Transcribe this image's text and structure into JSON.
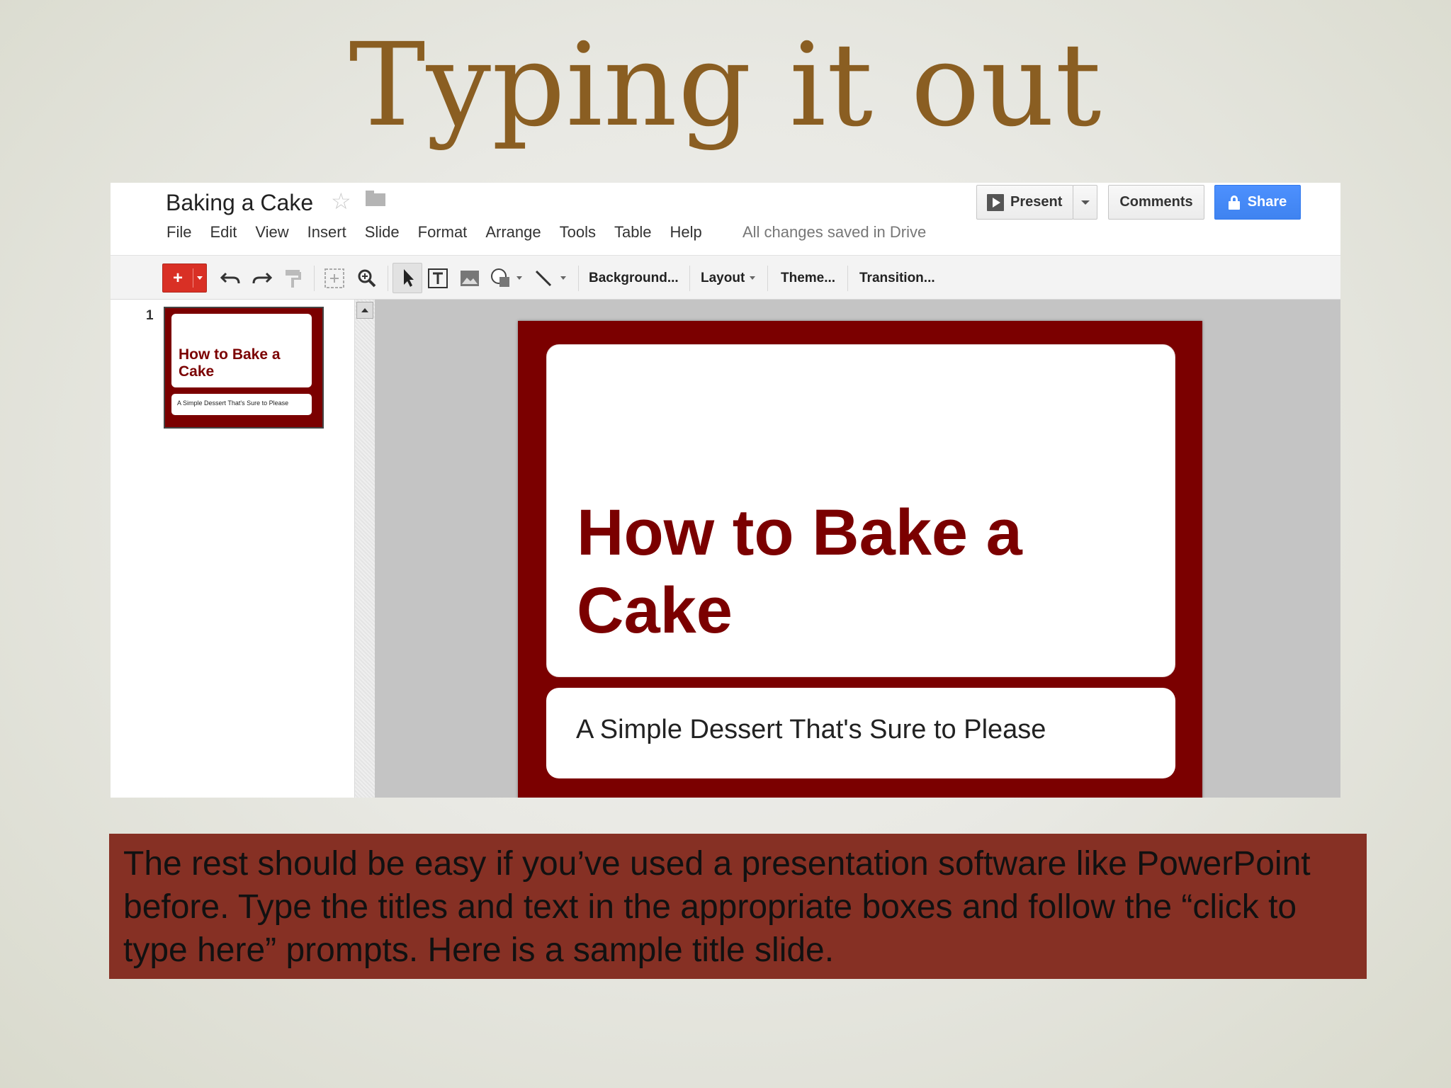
{
  "slide_heading": "Typing it out",
  "app": {
    "doc_title": "Baking a Cake",
    "menu": [
      "File",
      "Edit",
      "View",
      "Insert",
      "Slide",
      "Format",
      "Arrange",
      "Tools",
      "Table",
      "Help"
    ],
    "save_status": "All changes saved in Drive",
    "buttons": {
      "present": "Present",
      "comments": "Comments",
      "share": "Share"
    },
    "toolbar": {
      "new_slide": "+",
      "background": "Background...",
      "layout": "Layout",
      "theme": "Theme...",
      "transition": "Transition..."
    },
    "icons": [
      "star-icon",
      "folder-icon",
      "play-icon",
      "lock-icon",
      "undo-icon",
      "redo-icon",
      "paint-format-icon",
      "zoom-fit-icon",
      "zoom-icon",
      "cursor-icon",
      "text-box-icon",
      "image-icon",
      "shape-icon",
      "line-icon"
    ],
    "filmstrip": {
      "slide_number": "1",
      "thumb_title": "How to Bake a Cake",
      "thumb_subtitle": "A Simple Dessert That's Sure to Please"
    },
    "slide": {
      "title": "How to Bake a Cake",
      "subtitle": "A Simple Dessert That's Sure to Please"
    },
    "colors": {
      "slide_theme": "#7b0000",
      "share_button": "#4d90fe",
      "new_slide_button": "#d93025"
    }
  },
  "caption": "The rest should be easy if you’ve used a presentation software like PowerPoint before. Type the titles and text in the appropriate boxes and follow the “click to type here” prompts. Here is a sample title slide.",
  "colors": {
    "heading": "#8a5e22",
    "caption_background": "#863024"
  }
}
